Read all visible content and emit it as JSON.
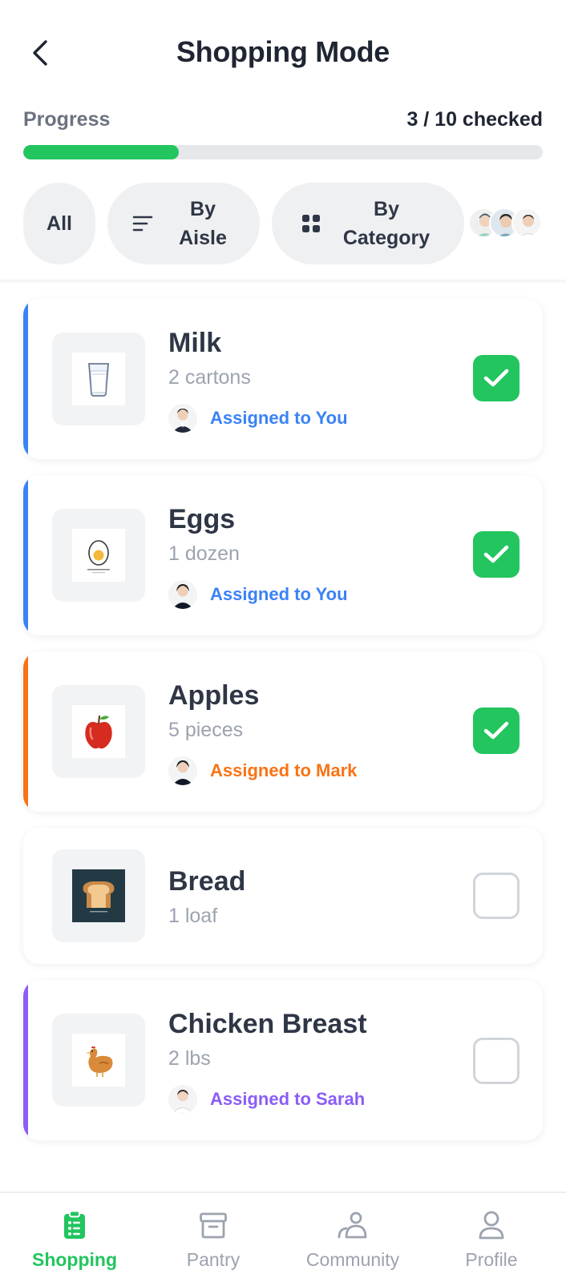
{
  "header": {
    "title": "Shopping Mode"
  },
  "progress": {
    "label": "Progress",
    "count_text": "3 / 10 checked",
    "checked": 3,
    "total": 10,
    "fill_fraction": 0.3,
    "color": "#22c55e"
  },
  "filters": {
    "all_label": "All",
    "aisle_label": "By Aisle",
    "category_label": "By Category",
    "aisle_icon": "sort-lines-icon",
    "category_icon": "grid-icon"
  },
  "items": [
    {
      "name": "Milk",
      "qty": "2 cartons",
      "assigned": "Assigned to You",
      "checked": true,
      "accent": "#3b82f6",
      "icon": "milk-glass-icon"
    },
    {
      "name": "Eggs",
      "qty": "1 dozen",
      "assigned": "Assigned to You",
      "checked": true,
      "accent": "#3b82f6",
      "icon": "egg-icon"
    },
    {
      "name": "Apples",
      "qty": "5 pieces",
      "assigned": "Assigned to Mark",
      "checked": true,
      "accent": "#f97316",
      "icon": "apple-icon"
    },
    {
      "name": "Bread",
      "qty": "1 loaf",
      "assigned": "",
      "checked": false,
      "accent": "",
      "icon": "bread-icon"
    },
    {
      "name": "Chicken Breast",
      "qty": "2 lbs",
      "assigned": "Assigned to Sarah",
      "checked": false,
      "accent": "#8b5cf6",
      "icon": "chicken-icon"
    }
  ],
  "nav": [
    {
      "label": "Shopping",
      "icon": "clipboard-list-icon",
      "active": true
    },
    {
      "label": "Pantry",
      "icon": "archive-box-icon",
      "active": false
    },
    {
      "label": "Community",
      "icon": "community-icon",
      "active": false
    },
    {
      "label": "Profile",
      "icon": "user-icon",
      "active": false
    }
  ],
  "colors": {
    "green": "#22c55e",
    "blue": "#3b82f6",
    "orange": "#f97316",
    "purple": "#8b5cf6",
    "text": "#2f3645",
    "muted": "#9ca3af"
  }
}
